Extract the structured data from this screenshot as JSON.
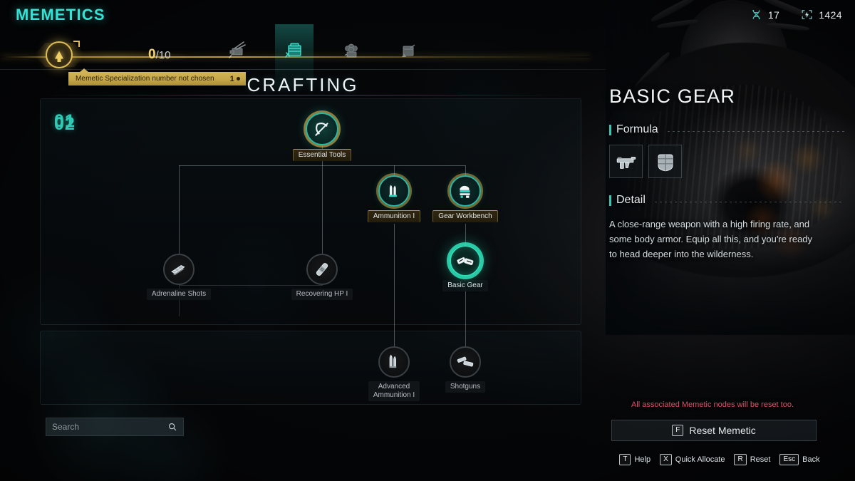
{
  "header": {
    "screen_title": "MEMETICS",
    "section_title": "CRAFTING",
    "resources": [
      {
        "icon": "dna-helix-icon",
        "value": "17"
      },
      {
        "icon": "energy-cell-icon",
        "value": "1424"
      }
    ],
    "progress": {
      "current": "0",
      "separator": "/",
      "max": "10"
    },
    "spec_banner": {
      "text": "Memetic Specialization number not chosen",
      "number": "1"
    },
    "categories": [
      {
        "icon": "weapon-bench-icon",
        "label": "Weapons",
        "active": false
      },
      {
        "icon": "crafting-bench-icon",
        "label": "Crafting",
        "active": true
      },
      {
        "icon": "survival-icon",
        "label": "Survival",
        "active": false
      },
      {
        "icon": "shelter-icon",
        "label": "Shelter",
        "active": false
      }
    ]
  },
  "tree": {
    "tiers": [
      {
        "number": "01"
      },
      {
        "number": "02"
      }
    ],
    "nodes": [
      {
        "id": "essential-tools",
        "label": "Essential Tools",
        "state": "root",
        "icon": "pickaxe-icon"
      },
      {
        "id": "ammunition-1",
        "label": "Ammunition I",
        "state": "unlocked",
        "icon": "bullets-icon"
      },
      {
        "id": "gear-workbench",
        "label": "Gear Workbench",
        "state": "unlocked",
        "icon": "workbench-icon"
      },
      {
        "id": "adrenaline-shots",
        "label": "Adrenaline Shots",
        "state": "locked",
        "icon": "syringe-stack-icon"
      },
      {
        "id": "recovering-hp-1",
        "label": "Recovering HP I",
        "state": "locked",
        "icon": "bandage-icon"
      },
      {
        "id": "basic-gear",
        "label": "Basic Gear",
        "state": "selected",
        "icon": "gear-pack-icon"
      },
      {
        "id": "advanced-ammunition-1",
        "label": "Advanced\nAmmunition I",
        "state": "locked",
        "icon": "rifle-rounds-icon"
      },
      {
        "id": "shotguns",
        "label": "Shotguns",
        "state": "locked",
        "icon": "shotgun-icon"
      }
    ]
  },
  "search": {
    "placeholder": "Search",
    "value": ""
  },
  "detail": {
    "title": "BASIC GEAR",
    "formula_heading": "Formula",
    "formula_items": [
      {
        "icon": "smg-icon",
        "name": "Submachine Gun"
      },
      {
        "icon": "body-armor-icon",
        "name": "Body Armor"
      }
    ],
    "detail_heading": "Detail",
    "description": "A close-range weapon with a high firing rate, and some body armor. Equip all this, and you're ready to head deeper into the wilderness."
  },
  "footer": {
    "reset_warning": "All associated Memetic nodes will be reset too.",
    "reset_button": {
      "key": "F",
      "label": "Reset Memetic"
    },
    "hints": [
      {
        "key": "T",
        "label": "Help"
      },
      {
        "key": "X",
        "label": "Quick Allocate"
      },
      {
        "key": "R",
        "label": "Reset"
      },
      {
        "key": "Esc",
        "label": "Back"
      }
    ]
  },
  "colors": {
    "accent_teal": "#2fc9b4",
    "title_teal": "#35e2d4",
    "gold": "#d3b457",
    "warning_red": "#e1506a"
  }
}
